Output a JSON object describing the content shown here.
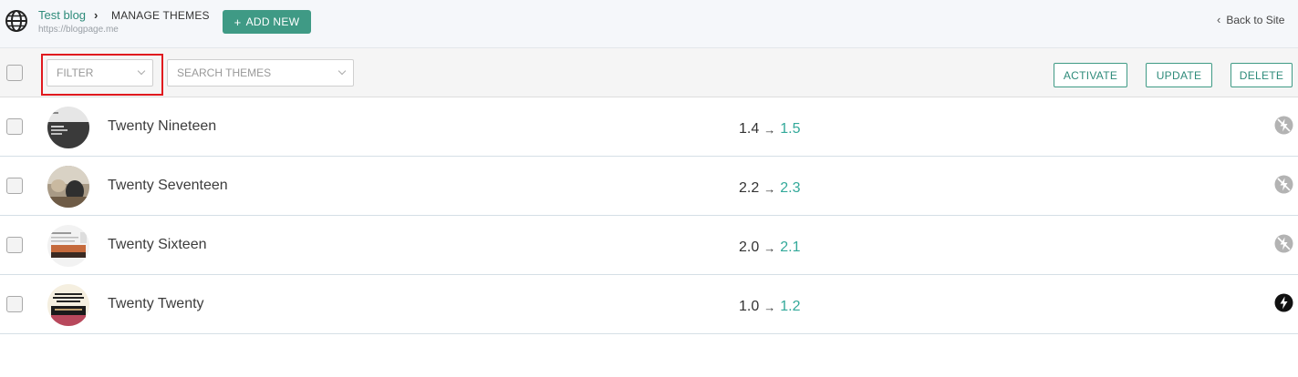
{
  "header": {
    "site_title": "Test blog",
    "separator": "›",
    "page_title": "MANAGE THEMES",
    "site_url": "https://blogpage.me",
    "add_new_label": "ADD NEW",
    "add_new_icon": "plus-icon",
    "back_label": "Back to Site"
  },
  "toolbar": {
    "filter_placeholder": "FILTER",
    "search_placeholder": "SEARCH THEMES",
    "actions": {
      "activate": "ACTIVATE",
      "update": "UPDATE",
      "delete": "DELETE"
    }
  },
  "themes": [
    {
      "name": "Twenty Nineteen",
      "current_version": "1.4",
      "new_version": "1.5",
      "autoupdate_icon": "autoupdate-disabled-icon"
    },
    {
      "name": "Twenty Seventeen",
      "current_version": "2.2",
      "new_version": "2.3",
      "autoupdate_icon": "autoupdate-disabled-icon"
    },
    {
      "name": "Twenty Sixteen",
      "current_version": "2.0",
      "new_version": "2.1",
      "autoupdate_icon": "autoupdate-disabled-icon"
    },
    {
      "name": "Twenty Twenty",
      "current_version": "1.0",
      "new_version": "1.2",
      "autoupdate_icon": "autoupdate-enabled-icon"
    }
  ],
  "colors": {
    "accent": "#3f9a85",
    "link": "#2e8b7a",
    "new_version": "#33a99a",
    "highlight": "#e0191e"
  }
}
